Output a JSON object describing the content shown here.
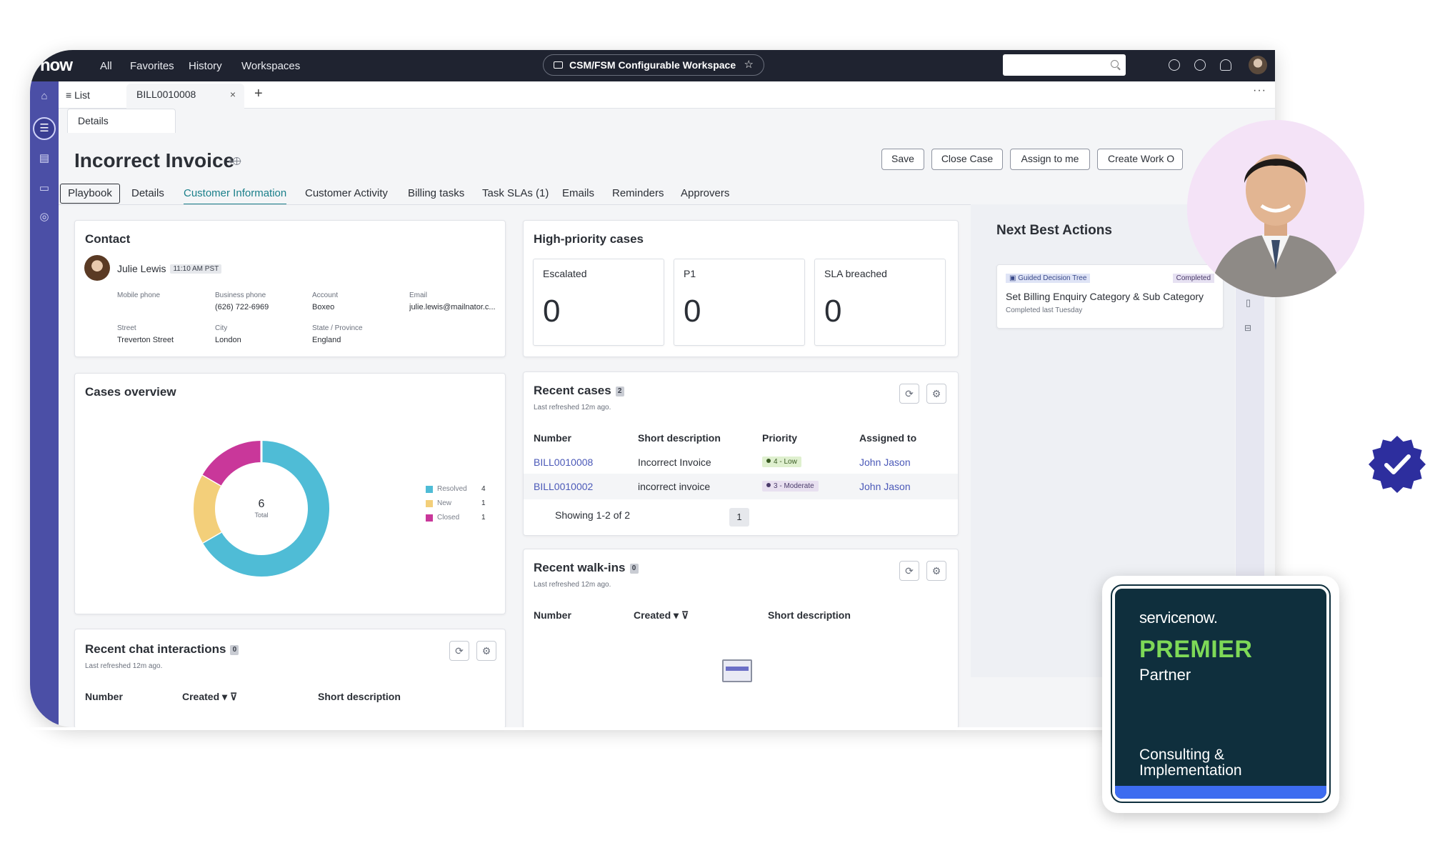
{
  "topbar": {
    "logo": "now",
    "nav": [
      "All",
      "Favorites",
      "History",
      "Workspaces"
    ],
    "workspace_title": "CSM/FSM Configurable Workspace",
    "search_placeholder": ""
  },
  "tabs": {
    "list_label": "List",
    "record_tab": "BILL0010008",
    "sub_tab": "Details"
  },
  "record": {
    "title": "Incorrect Invoice",
    "buttons": [
      "Save",
      "Close Case",
      "Assign to me",
      "Create Work O"
    ],
    "tabs": [
      "Playbook",
      "Details",
      "Customer Information",
      "Customer Activity",
      "Billing tasks",
      "Task SLAs (1)",
      "Emails",
      "Reminders",
      "Approvers"
    ]
  },
  "contact": {
    "title": "Contact",
    "name": "Julie Lewis",
    "local_time": "11:10 AM PST",
    "fields": [
      {
        "label": "Mobile phone",
        "value": ""
      },
      {
        "label": "Business phone",
        "value": "(626) 722-6969"
      },
      {
        "label": "Account",
        "value": "Boxeo"
      },
      {
        "label": "Email",
        "value": "julie.lewis@mailnator.c..."
      },
      {
        "label": "Street",
        "value": "Treverton Street"
      },
      {
        "label": "City",
        "value": "London"
      },
      {
        "label": "State / Province",
        "value": "England"
      }
    ]
  },
  "high_priority": {
    "title": "High-priority cases",
    "kpis": [
      {
        "label": "Escalated",
        "value": "0"
      },
      {
        "label": "P1",
        "value": "0"
      },
      {
        "label": "SLA breached",
        "value": "0"
      }
    ]
  },
  "cases_overview": {
    "title": "Cases overview",
    "total": "6",
    "total_label": "Total"
  },
  "chart_data": {
    "type": "pie",
    "donut": true,
    "categories": [
      "Resolved",
      "New",
      "Closed"
    ],
    "values": [
      4,
      1,
      1
    ],
    "colors": [
      "#4fbcd6",
      "#f3cf7a",
      "#c9379a"
    ],
    "legend": "right"
  },
  "recent_cases": {
    "title": "Recent cases",
    "count": "2",
    "refreshed": "Last refreshed 12m ago.",
    "columns": [
      "Number",
      "Short description",
      "Priority",
      "Assigned to"
    ],
    "rows": [
      {
        "number": "BILL0010008",
        "desc": "Incorrect Invoice",
        "priority": "4 - Low",
        "assigned": "John Jason"
      },
      {
        "number": "BILL0010002",
        "desc": "incorrect invoice",
        "priority": "3 - Moderate",
        "assigned": "John Jason"
      }
    ],
    "showing": "Showing 1-2 of 2",
    "page": "1"
  },
  "recent_walkins": {
    "title": "Recent walk-ins",
    "count": "0",
    "refreshed": "Last refreshed 12m ago.",
    "columns": [
      "Number",
      "Created",
      "Short description"
    ]
  },
  "recent_chat": {
    "title": "Recent chat interactions",
    "count": "0",
    "refreshed": "Last refreshed 12m ago.",
    "columns": [
      "Number",
      "Created",
      "Short description"
    ]
  },
  "nba": {
    "title": "Next Best Actions",
    "card_tag": "Guided Decision Tree",
    "card_status": "Completed",
    "card_title": "Set Billing Enquiry Category & Sub Category",
    "card_meta": "Completed last Tuesday"
  },
  "badge": {
    "logo_text": "servicenow.",
    "title": "PREMIER",
    "subtitle": "Partner",
    "description": "Consulting & Implementation"
  },
  "colors": {
    "rail": "#4b4fa6",
    "topbar": "#1f2330",
    "accent_teal": "#1a7f8a",
    "link": "#4b59b8",
    "badge_bg": "#0f2f3d",
    "badge_green": "#7ed957",
    "verified": "#2d2e9e"
  }
}
